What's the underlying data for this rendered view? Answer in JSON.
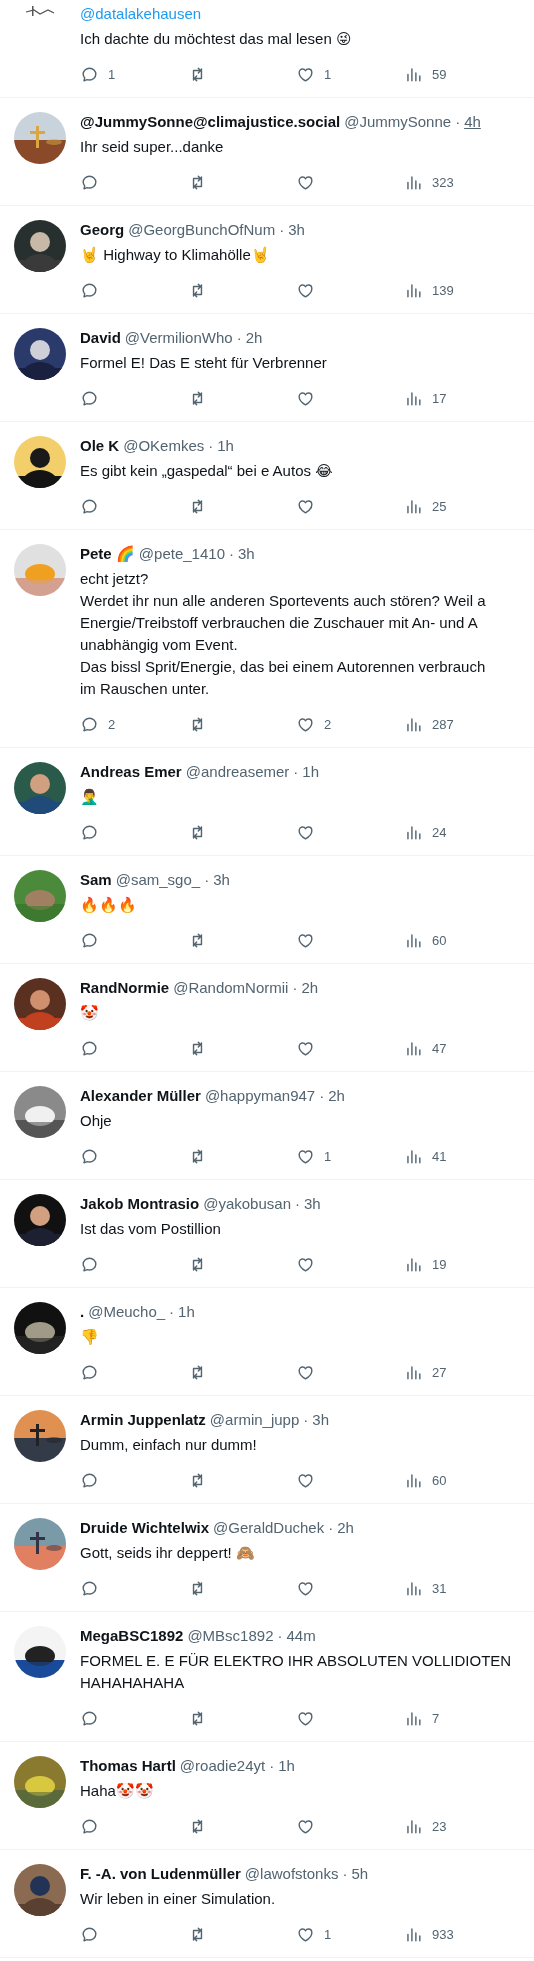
{
  "replies": [
    {
      "mention": "@datalakehausen",
      "body": [
        "Ich dachte du möchtest das mal lesen 😜"
      ],
      "actions": [
        {
          "kind": "reply",
          "count": "1"
        },
        {
          "kind": "retweet"
        },
        {
          "kind": "like",
          "count": "1"
        },
        {
          "kind": "views",
          "count": "59"
        }
      ]
    },
    {
      "name": "@JummySonne@climajustice.social",
      "handle": "@JummySonne",
      "dot": "·",
      "time": "4h",
      "time_hovered": true,
      "body": [
        "Ihr seid super...danke"
      ],
      "actions": [
        {
          "kind": "reply"
        },
        {
          "kind": "retweet"
        },
        {
          "kind": "like"
        },
        {
          "kind": "views",
          "count": "323"
        }
      ]
    },
    {
      "name": "Georg",
      "handle": "@GeorgBunchOfNum",
      "dot": "·",
      "time": "3h",
      "time_hovered": false,
      "body": [
        "🤘 Highway to Klimahölle🤘"
      ],
      "actions": [
        {
          "kind": "reply"
        },
        {
          "kind": "retweet"
        },
        {
          "kind": "like"
        },
        {
          "kind": "views",
          "count": "139"
        }
      ]
    },
    {
      "name": "David",
      "handle": "@VermilionWho",
      "dot": "·",
      "time": "2h",
      "time_hovered": false,
      "body": [
        "Formel E! Das E steht für Verbrenner"
      ],
      "actions": [
        {
          "kind": "reply"
        },
        {
          "kind": "retweet"
        },
        {
          "kind": "like"
        },
        {
          "kind": "views",
          "count": "17"
        }
      ]
    },
    {
      "name": "Ole K",
      "handle": "@OKemkes",
      "dot": "·",
      "time": "1h",
      "time_hovered": false,
      "body": [
        "Es gibt kein „gaspedal“ bei e Autos 😂"
      ],
      "actions": [
        {
          "kind": "reply"
        },
        {
          "kind": "retweet"
        },
        {
          "kind": "like"
        },
        {
          "kind": "views",
          "count": "25"
        }
      ]
    },
    {
      "name": "Pete 🌈",
      "handle": "@pete_1410",
      "dot": "·",
      "time": "3h",
      "time_hovered": false,
      "body": [
        "echt jetzt?",
        "Werdet ihr nun alle anderen Sportevents auch stören? Weil a",
        "Energie/Treibstoff verbrauchen die Zuschauer mit An- und A",
        "unabhängig vom Event.",
        "Das bissl Sprit/Energie, das bei einem Autorennen verbrauch",
        "im Rauschen unter."
      ],
      "actions": [
        {
          "kind": "reply",
          "count": "2"
        },
        {
          "kind": "retweet"
        },
        {
          "kind": "like",
          "count": "2"
        },
        {
          "kind": "views",
          "count": "287"
        }
      ]
    },
    {
      "name": "Andreas Emer",
      "handle": "@andreasemer",
      "dot": "·",
      "time": "1h",
      "time_hovered": false,
      "body": [
        "🤦‍♂️"
      ],
      "actions": [
        {
          "kind": "reply"
        },
        {
          "kind": "retweet"
        },
        {
          "kind": "like"
        },
        {
          "kind": "views",
          "count": "24"
        }
      ]
    },
    {
      "name": "Sam",
      "handle": "@sam_sgo_",
      "dot": "·",
      "time": "3h",
      "time_hovered": false,
      "body": [
        "🔥🔥🔥"
      ],
      "actions": [
        {
          "kind": "reply"
        },
        {
          "kind": "retweet"
        },
        {
          "kind": "like"
        },
        {
          "kind": "views",
          "count": "60"
        }
      ]
    },
    {
      "name": "RandNormie",
      "handle": "@RandomNormii",
      "dot": "·",
      "time": "2h",
      "time_hovered": false,
      "body": [
        "🤡"
      ],
      "actions": [
        {
          "kind": "reply"
        },
        {
          "kind": "retweet"
        },
        {
          "kind": "like"
        },
        {
          "kind": "views",
          "count": "47"
        }
      ]
    },
    {
      "name": "Alexander Müller",
      "handle": "@happyman947",
      "dot": "·",
      "time": "2h",
      "time_hovered": false,
      "body": [
        "Ohje"
      ],
      "actions": [
        {
          "kind": "reply"
        },
        {
          "kind": "retweet"
        },
        {
          "kind": "like",
          "count": "1"
        },
        {
          "kind": "views",
          "count": "41"
        }
      ]
    },
    {
      "name": "Jakob Montrasio",
      "handle": "@yakobusan",
      "dot": "·",
      "time": "3h",
      "time_hovered": false,
      "body": [
        "Ist das vom Postillion"
      ],
      "actions": [
        {
          "kind": "reply"
        },
        {
          "kind": "retweet"
        },
        {
          "kind": "like"
        },
        {
          "kind": "views",
          "count": "19"
        }
      ]
    },
    {
      "name": ".",
      "handle": "@Meucho_",
      "dot": "·",
      "time": "1h",
      "time_hovered": false,
      "body": [
        "👎"
      ],
      "actions": [
        {
          "kind": "reply"
        },
        {
          "kind": "retweet"
        },
        {
          "kind": "like"
        },
        {
          "kind": "views",
          "count": "27"
        }
      ]
    },
    {
      "name": "Armin Juppenlatz",
      "handle": "@armin_jupp",
      "dot": "·",
      "time": "3h",
      "time_hovered": false,
      "body": [
        "Dumm, einfach nur dumm!"
      ],
      "actions": [
        {
          "kind": "reply"
        },
        {
          "kind": "retweet"
        },
        {
          "kind": "like"
        },
        {
          "kind": "views",
          "count": "60"
        }
      ]
    },
    {
      "name": "Druide Wichtelwix",
      "handle": "@GeraldDuchek",
      "dot": "·",
      "time": "2h",
      "time_hovered": false,
      "body": [
        "Gott, seids ihr deppert! 🙈"
      ],
      "actions": [
        {
          "kind": "reply"
        },
        {
          "kind": "retweet"
        },
        {
          "kind": "like"
        },
        {
          "kind": "views",
          "count": "31"
        }
      ]
    },
    {
      "name": "MegaBSC1892",
      "handle": "@MBsc1892",
      "dot": "·",
      "time": "44m",
      "time_hovered": false,
      "body": [
        "FORMEL E. E FÜR ELEKTRO IHR ABSOLUTEN VOLLIDIOTEN",
        "HAHAHAHAHA"
      ],
      "actions": [
        {
          "kind": "reply"
        },
        {
          "kind": "retweet"
        },
        {
          "kind": "like"
        },
        {
          "kind": "views",
          "count": "7"
        }
      ]
    },
    {
      "name": "Thomas Hartl",
      "handle": "@roadie24yt",
      "dot": "·",
      "time": "1h",
      "time_hovered": false,
      "body": [
        "Haha🤡🤡"
      ],
      "actions": [
        {
          "kind": "reply"
        },
        {
          "kind": "retweet"
        },
        {
          "kind": "like"
        },
        {
          "kind": "views",
          "count": "23"
        }
      ]
    },
    {
      "name": "F. -A. von Ludenmüller",
      "handle": "@lawofstonks",
      "dot": "·",
      "time": "5h",
      "time_hovered": false,
      "body": [
        "Wir leben in einer Simulation."
      ],
      "actions": [
        {
          "kind": "reply"
        },
        {
          "kind": "retweet"
        },
        {
          "kind": "like",
          "count": "1"
        },
        {
          "kind": "views",
          "count": "933"
        }
      ]
    }
  ]
}
